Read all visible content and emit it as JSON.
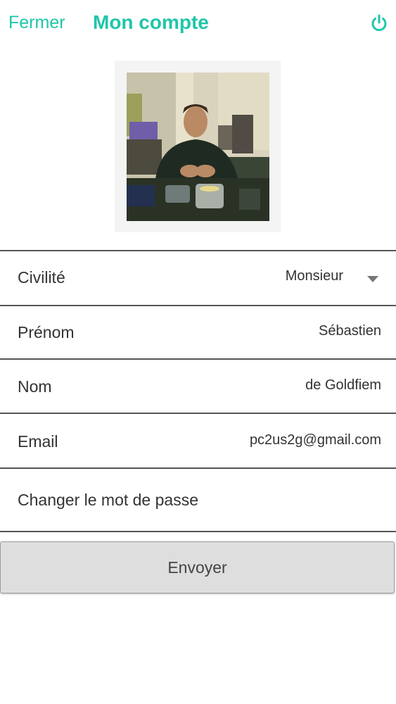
{
  "header": {
    "close_label": "Fermer",
    "title": "Mon compte",
    "power_icon": "power-icon"
  },
  "colors": {
    "accent": "#1fc6a9",
    "divider": "#555555",
    "button_bg": "#dedede"
  },
  "profile": {
    "avatar": "profile-photo"
  },
  "form": {
    "civility": {
      "label": "Civilité",
      "value": "Monsieur"
    },
    "first_name": {
      "label": "Prénom",
      "value": "Sébastien"
    },
    "last_name": {
      "label": "Nom",
      "value": "de Goldfiem"
    },
    "email": {
      "label": "Email",
      "value": "pc2us2g@gmail.com"
    },
    "change_password": {
      "label": "Changer le mot de passe"
    },
    "submit_label": "Envoyer"
  }
}
